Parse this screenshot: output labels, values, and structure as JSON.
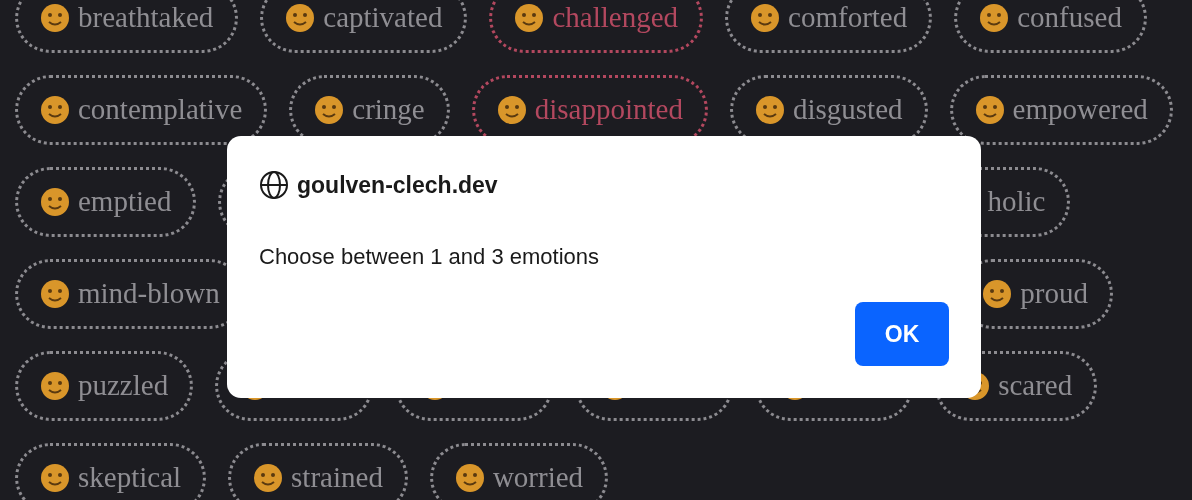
{
  "emotion_rows": [
    {
      "pills": [
        {
          "label": "breathtaked",
          "selected": false,
          "kind": "full"
        },
        {
          "label": "captivated",
          "selected": false,
          "kind": "full"
        },
        {
          "label": "challenged",
          "selected": true,
          "kind": "full"
        },
        {
          "label": "comforted",
          "selected": false,
          "kind": "full"
        },
        {
          "label": "confused",
          "selected": false,
          "kind": "full"
        }
      ]
    },
    {
      "pills": [
        {
          "label": "contemplative",
          "selected": false,
          "kind": "full"
        },
        {
          "label": "cringe",
          "selected": false,
          "kind": "full"
        },
        {
          "label": "disappointed",
          "selected": true,
          "kind": "full"
        },
        {
          "label": "disgusted",
          "selected": false,
          "kind": "full"
        },
        {
          "label": "empowered",
          "selected": false,
          "kind": "full"
        }
      ]
    },
    {
      "pills": [
        {
          "label": "emptied",
          "selected": false,
          "kind": "full"
        },
        {
          "label": "holic",
          "selected": false,
          "kind": "tail"
        }
      ]
    },
    {
      "pills": [
        {
          "label": "mind-blown",
          "selected": false,
          "kind": "full"
        },
        {
          "label": "proud",
          "selected": false,
          "kind": "end"
        }
      ]
    },
    {
      "pills": [
        {
          "label": "puzzled",
          "selected": false,
          "kind": "full"
        },
        {
          "selected": false,
          "kind": "covered"
        },
        {
          "selected": false,
          "kind": "covered"
        },
        {
          "selected": false,
          "kind": "covered"
        },
        {
          "selected": false,
          "kind": "covered"
        },
        {
          "label": "scared",
          "selected": false,
          "kind": "full"
        }
      ]
    },
    {
      "pills": [
        {
          "label": "skeptical",
          "selected": false,
          "kind": "full"
        },
        {
          "label": "strained",
          "selected": false,
          "kind": "full"
        },
        {
          "label": "worried",
          "selected": false,
          "kind": "full"
        }
      ]
    }
  ],
  "dialog": {
    "site": "goulven-clech.dev",
    "message": "Choose between 1 and 3 emotions",
    "button": "OK"
  }
}
